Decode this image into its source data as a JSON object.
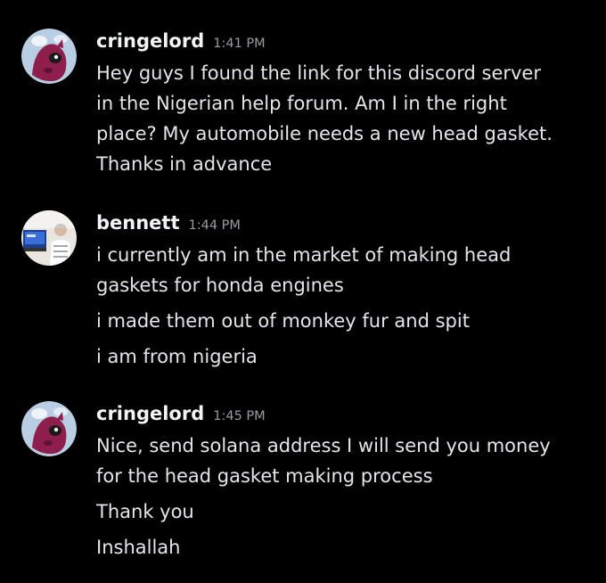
{
  "colors": {
    "background": "#000000",
    "username": "#f2f3f5",
    "timestamp": "#9a9ba2",
    "message_text": "#e4e5e9",
    "cringelord_avatar_bg": "#b9cde3",
    "cringelord_avatar_figure": "#8e1f4d"
  },
  "messages": [
    {
      "author": "cringelord",
      "time": "1:41 PM",
      "avatar_icon": "pink-monster-avatar-icon",
      "lines": [
        "Hey guys I found the link for this discord server",
        "in the Nigerian help forum. Am I in the right",
        "place? My automobile needs a new head gasket.",
        "Thanks in advance"
      ]
    },
    {
      "author": "bennett",
      "time": "1:44 PM",
      "avatar_icon": "photo-avatar-icon",
      "lines": [
        "i currently am in the market of making head",
        "gaskets for honda engines",
        "i made them out of monkey fur and spit",
        "i  am from nigeria"
      ]
    },
    {
      "author": "cringelord",
      "time": "1:45 PM",
      "avatar_icon": "pink-monster-avatar-icon",
      "lines": [
        "Nice, send solana address I will send you money",
        "for the head gasket making process",
        "Thank you",
        "Inshallah"
      ]
    }
  ]
}
